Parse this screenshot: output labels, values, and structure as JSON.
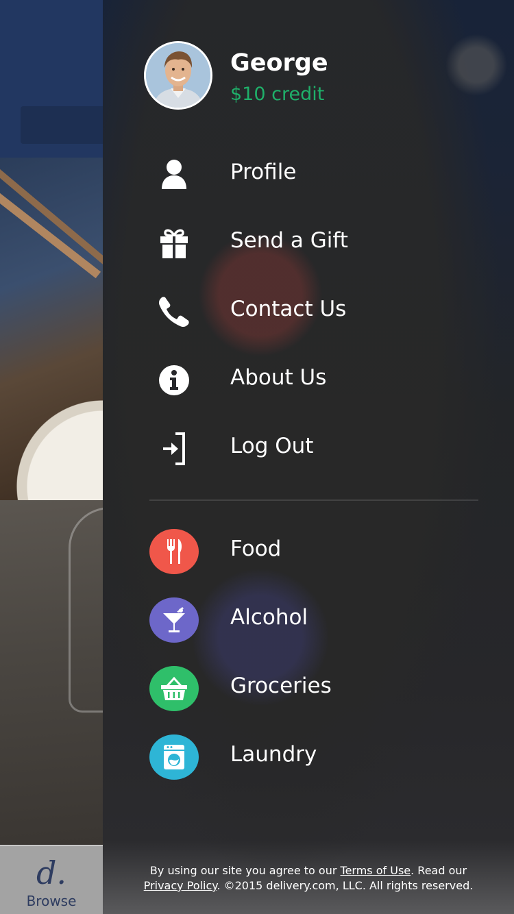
{
  "user": {
    "name": "George",
    "credit": "$10 credit"
  },
  "menu": {
    "items": [
      {
        "label": "Profile",
        "icon": "user-icon"
      },
      {
        "label": "Send a Gift",
        "icon": "gift-icon"
      },
      {
        "label": "Contact Us",
        "icon": "phone-icon"
      },
      {
        "label": "About Us",
        "icon": "info-icon"
      },
      {
        "label": "Log Out",
        "icon": "logout-icon"
      }
    ]
  },
  "categories": [
    {
      "label": "Food",
      "icon": "fork-knife-icon",
      "color": "#f0574a"
    },
    {
      "label": "Alcohol",
      "icon": "cocktail-icon",
      "color": "#6d67c9"
    },
    {
      "label": "Groceries",
      "icon": "basket-icon",
      "color": "#2fbf6a"
    },
    {
      "label": "Laundry",
      "icon": "washing-machine-icon",
      "color": "#2eb5d6"
    }
  ],
  "footer": {
    "text_before": "By using our site you agree to our ",
    "terms_link": "Terms of Use",
    "text_middle": ". Read our",
    "privacy_link": "Privacy Policy",
    "text_after": ". ©2015 delivery.com, LLC. All rights reserved."
  },
  "tabbar": {
    "logo": "d.",
    "label": "Browse"
  },
  "colors": {
    "credit": "#1fb06a",
    "header_bg": "#223761"
  }
}
